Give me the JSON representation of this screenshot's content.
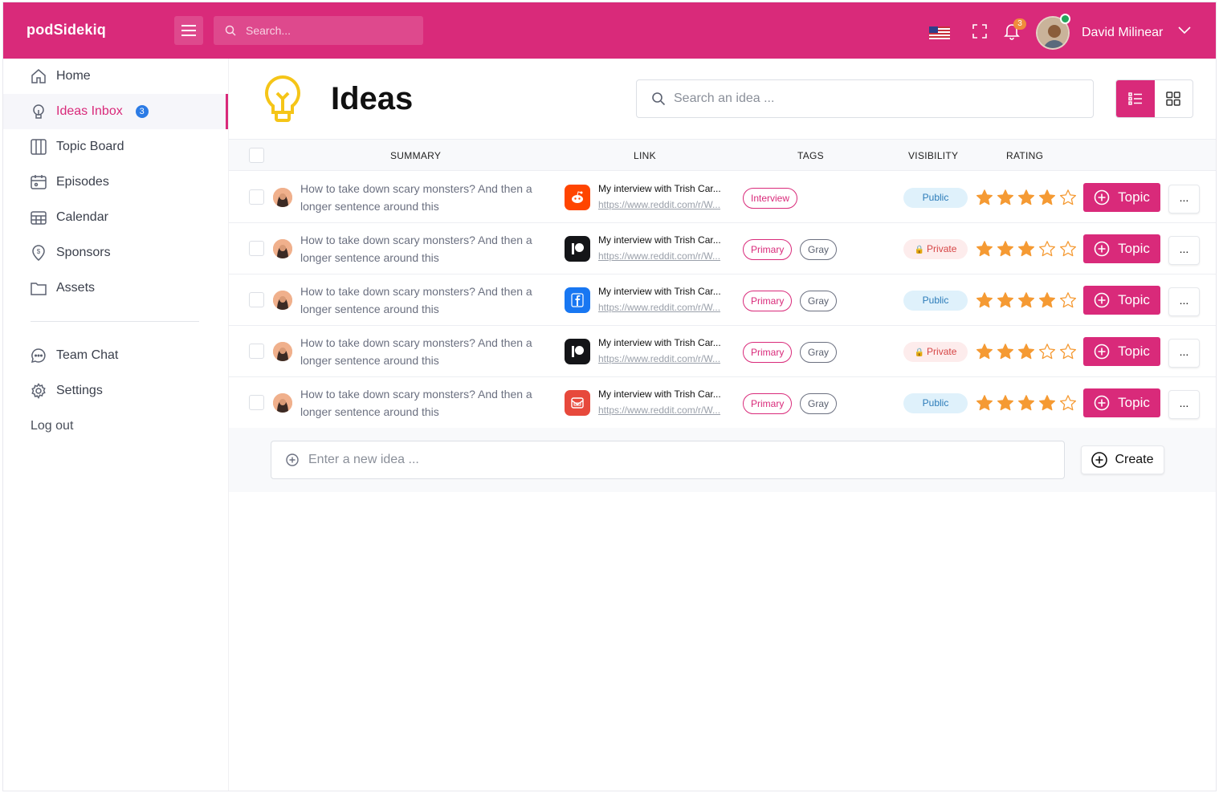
{
  "app": {
    "logo_text": "podSidekiq"
  },
  "header": {
    "search_placeholder": "Search...",
    "notification_count": "3",
    "user_name": "David Milinear"
  },
  "sidebar": {
    "items": [
      {
        "label": "Home",
        "icon": "home-icon"
      },
      {
        "label": "Ideas Inbox",
        "icon": "lightbulb-icon",
        "badge": "3",
        "active": true
      },
      {
        "label": "Topic Board",
        "icon": "columns-icon"
      },
      {
        "label": "Episodes",
        "icon": "calendar-clock-icon"
      },
      {
        "label": "Calendar",
        "icon": "calendar-grid-icon"
      },
      {
        "label": "Sponsors",
        "icon": "dollar-pin-icon"
      },
      {
        "label": "Assets",
        "icon": "folder-icon"
      },
      {
        "label": "Team Chat",
        "icon": "chat-icon"
      },
      {
        "label": "Settings",
        "icon": "gear-icon"
      }
    ],
    "logout": "Log out"
  },
  "main": {
    "title": "Ideas",
    "search_placeholder": "Search an idea ...",
    "columns": {
      "summary": "SUMMARY",
      "link": "LINK",
      "tags": "TAGS",
      "visibility": "VISIBILITY",
      "rating": "RATING"
    },
    "rows": [
      {
        "summary": "How to take down scary monsters? And then a longer sentence around this",
        "source": "reddit",
        "link_title": "My interview with Trish Car...",
        "link_url": "https://www.reddit.com/r/W...",
        "tags": [
          "Interview"
        ],
        "visibility": "Public",
        "rating": 4,
        "topic": "Topic",
        "more": "..."
      },
      {
        "summary": "How to take down scary monsters? And then a longer sentence around this",
        "source": "patreon",
        "link_title": "My interview with Trish Car...",
        "link_url": "https://www.reddit.com/r/W...",
        "tags": [
          "Primary",
          "Gray"
        ],
        "visibility": "Private",
        "rating": 3,
        "topic": "Topic",
        "more": "..."
      },
      {
        "summary": "How to take down scary monsters? And then a longer sentence around this",
        "source": "facebook",
        "link_title": "My interview with Trish Car...",
        "link_url": "https://www.reddit.com/r/W...",
        "tags": [
          "Primary",
          "Gray"
        ],
        "visibility": "Public",
        "rating": 4,
        "topic": "Topic",
        "more": "..."
      },
      {
        "summary": "How to take down scary monsters? And then a longer sentence around this",
        "source": "patreon",
        "link_title": "My interview with Trish Car...",
        "link_url": "https://www.reddit.com/r/W...",
        "tags": [
          "Primary",
          "Gray"
        ],
        "visibility": "Private",
        "rating": 3,
        "topic": "Topic",
        "more": "..."
      },
      {
        "summary": "How to take down scary monsters? And then a longer sentence around this",
        "source": "gmail",
        "link_title": "My interview with Trish Car...",
        "link_url": "https://www.reddit.com/r/W...",
        "tags": [
          "Primary",
          "Gray"
        ],
        "visibility": "Public",
        "rating": 4,
        "topic": "Topic",
        "more": "..."
      }
    ],
    "new_idea_placeholder": "Enter a new idea ...",
    "create_label": "Create"
  },
  "colors": {
    "brand": "#d92a7a",
    "star": "#f59a33",
    "public_bg": "#dff1fb",
    "private_bg": "#fdecec"
  }
}
